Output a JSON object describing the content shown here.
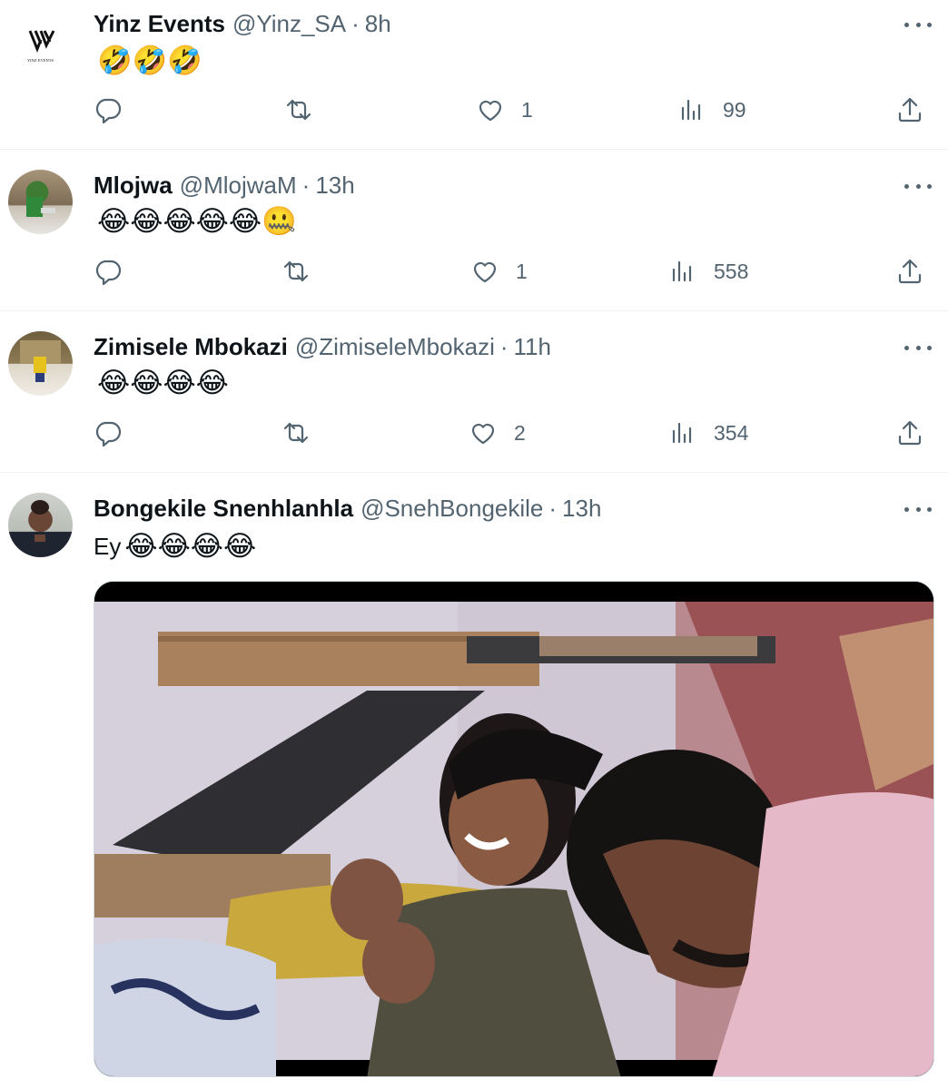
{
  "tweets": [
    {
      "name": "Yinz Events",
      "handle": "@Yinz_SA",
      "dot": "·",
      "time": "8h",
      "text": "",
      "emoji": "🤣🤣🤣",
      "avatar_label": "YINZ EVENTS",
      "reply_count": "",
      "retweet_count": "",
      "like_count": "1",
      "view_count": "99"
    },
    {
      "name": "Mlojwa",
      "handle": "@MlojwaM",
      "dot": "·",
      "time": "13h",
      "text": "",
      "emoji": "😂😂😂😂😂🤐",
      "reply_count": "",
      "retweet_count": "",
      "like_count": "1",
      "view_count": "558"
    },
    {
      "name": "Zimisele Mbokazi",
      "handle": "@ZimiseleMbokazi",
      "dot": "·",
      "time": "11h",
      "text": "",
      "emoji": "😂😂😂😂",
      "reply_count": "",
      "retweet_count": "",
      "like_count": "2",
      "view_count": "354"
    },
    {
      "name": "Bongekile Snenhlanhla",
      "handle": "@SnehBongekile",
      "dot": "·",
      "time": "13h",
      "text": "Ey",
      "emoji": "😂😂😂😂"
    }
  ],
  "icons": {
    "reply": "reply-icon",
    "retweet": "retweet-icon",
    "like": "heart-icon",
    "views": "views-icon",
    "share": "share-icon",
    "more": "more-icon"
  }
}
